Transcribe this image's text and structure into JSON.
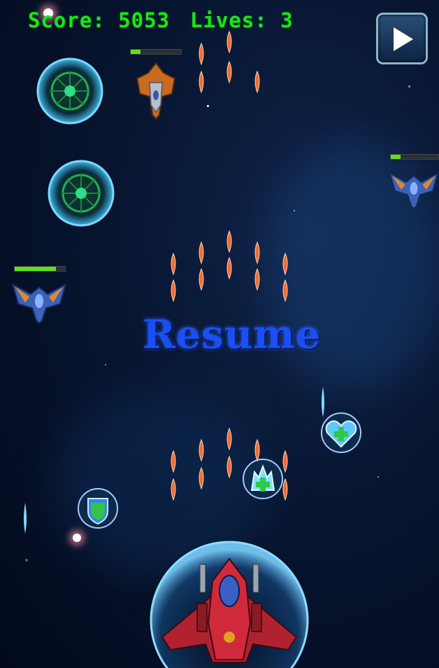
{
  "hud": {
    "score_label": "Score: 5053",
    "lives_label": "Lives: 3",
    "score_value": 5053,
    "lives_value": 3
  },
  "pause_overlay": {
    "resume_label": "Resume",
    "play_button_icon": "play-icon"
  },
  "enemies": [
    {
      "type": "orange-fighter",
      "health_fraction": 0.2
    },
    {
      "type": "blue-fighter-left",
      "health_fraction": 0.82
    },
    {
      "type": "blue-fighter-right",
      "health_fraction": 0.2
    }
  ],
  "powerups": [
    "shield-powerup",
    "health-heart-powerup",
    "health-crystal-powerup"
  ],
  "colors": {
    "hud_text": "#19e619",
    "resume_text": "#1b4ff2",
    "enemy_bullet": "#f06a3a",
    "health_fill": "#5fe01c"
  }
}
